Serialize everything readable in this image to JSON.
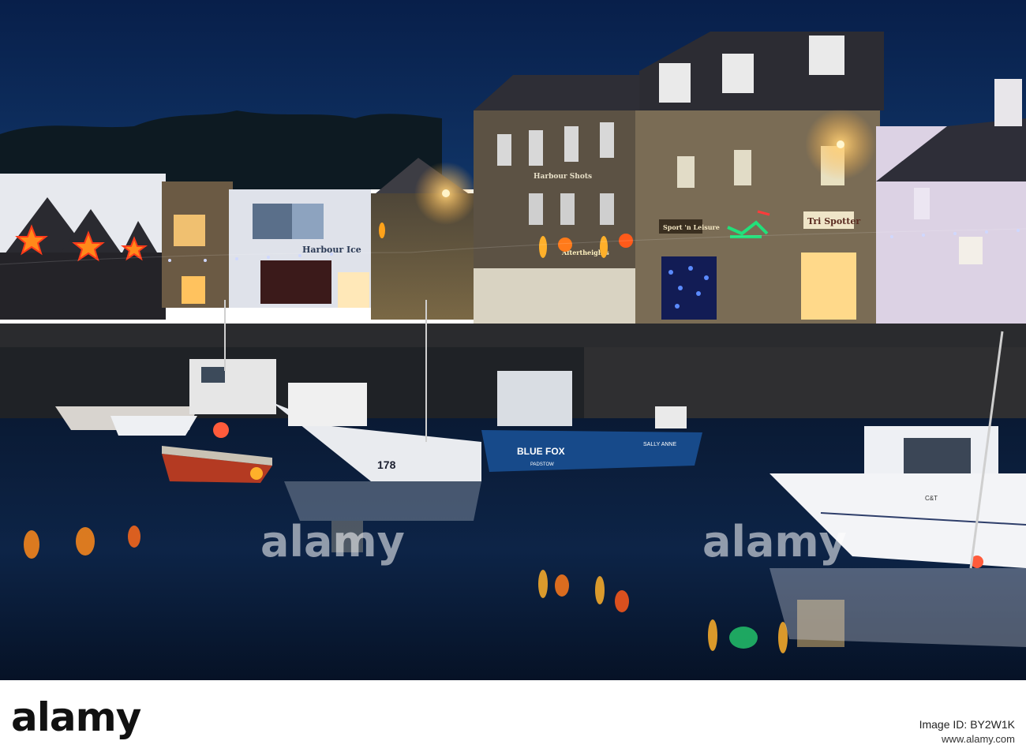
{
  "photo": {
    "description_tag": "harbour-at-dusk",
    "signs": {
      "shop_1": "Harbour Ice",
      "shop_2": "Sport 'n Leisure",
      "shop_3": "Tri Spotter",
      "shop_4": "Harbour Shots",
      "shop_5": "Aftertheights"
    },
    "boats": {
      "boat_1_number": "178",
      "boat_2_name": "BLUE FOX",
      "boat_2_port": "PADSTOW",
      "boat_3_name": "SALLY ANNE",
      "boat_4_mark": "C&T"
    },
    "colors": {
      "sky": "#0b2a5a",
      "water": "#06152e",
      "lamp": "#ffc24a",
      "star": "#ff8a1a"
    }
  },
  "watermark": {
    "text_1": "alamy",
    "text_2": "alamy"
  },
  "footer": {
    "logo": "alamy",
    "image_id_label": "Image ID:",
    "image_id": "BY2W1K",
    "site": "www.alamy.com"
  }
}
